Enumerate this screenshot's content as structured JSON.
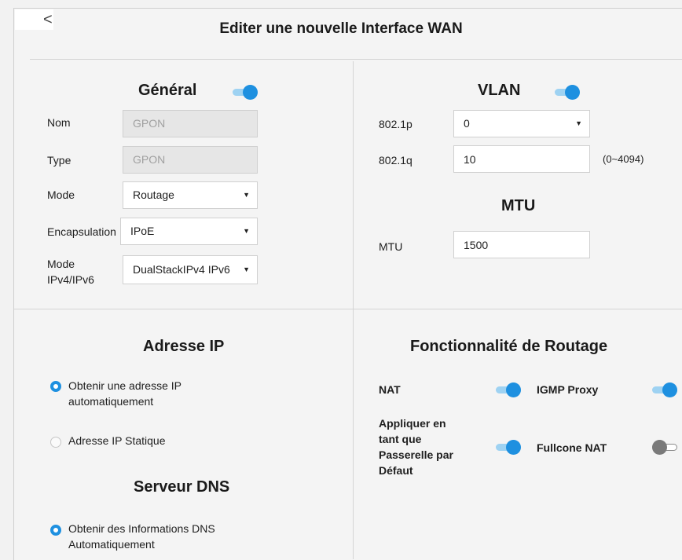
{
  "page": {
    "title": "Editer une nouvelle Interface WAN",
    "back_glyph": "<"
  },
  "general": {
    "title": "Général",
    "enabled": true,
    "fields": {
      "nom": {
        "label": "Nom",
        "value": "GPON"
      },
      "type": {
        "label": "Type",
        "value": "GPON"
      },
      "mode": {
        "label": "Mode",
        "value": "Routage"
      },
      "encapsulation": {
        "label": "Encapsulation",
        "value": "IPoE"
      },
      "ipmode": {
        "label_line1": "Mode",
        "label_line2": "IPv4/IPv6",
        "value": "DualStackIPv4 IPv6"
      }
    }
  },
  "vlan": {
    "title": "VLAN",
    "enabled": true,
    "p8021": {
      "label": "802.1p",
      "value": "0"
    },
    "q8021": {
      "label": "802.1q",
      "value": "10",
      "hint": "(0~4094)"
    }
  },
  "mtu": {
    "title": "MTU",
    "label": "MTU",
    "value": "1500"
  },
  "ip_address": {
    "title": "Adresse IP",
    "options": [
      {
        "line1": "Obtenir une adresse IP",
        "line2": "automatiquement",
        "selected": true
      },
      {
        "line1": "Adresse IP Statique",
        "selected": false
      }
    ]
  },
  "dns": {
    "title": "Serveur DNS",
    "options": [
      {
        "line1": "Obtenir des Informations DNS",
        "line2": "Automatiquement",
        "selected": true
      }
    ]
  },
  "routing": {
    "title": "Fonctionnalité de Routage",
    "nat": {
      "label": "NAT",
      "enabled": true
    },
    "igmp": {
      "label": "IGMP Proxy",
      "enabled": true
    },
    "gateway": {
      "lines": [
        "Appliquer en",
        "tant que",
        "Passerelle par",
        "Défaut"
      ],
      "enabled": true
    },
    "fullcone": {
      "label": "Fullcone NAT",
      "enabled": false
    }
  },
  "icons": {
    "back": "chevron-left-icon",
    "dropdown": "caret-down-icon"
  },
  "colors": {
    "accent": "#1e90e0",
    "toggle_track_on": "#9ed2f2",
    "toggle_knob_off": "#7a7a7a",
    "disabled_field": "#e6e6e6"
  }
}
